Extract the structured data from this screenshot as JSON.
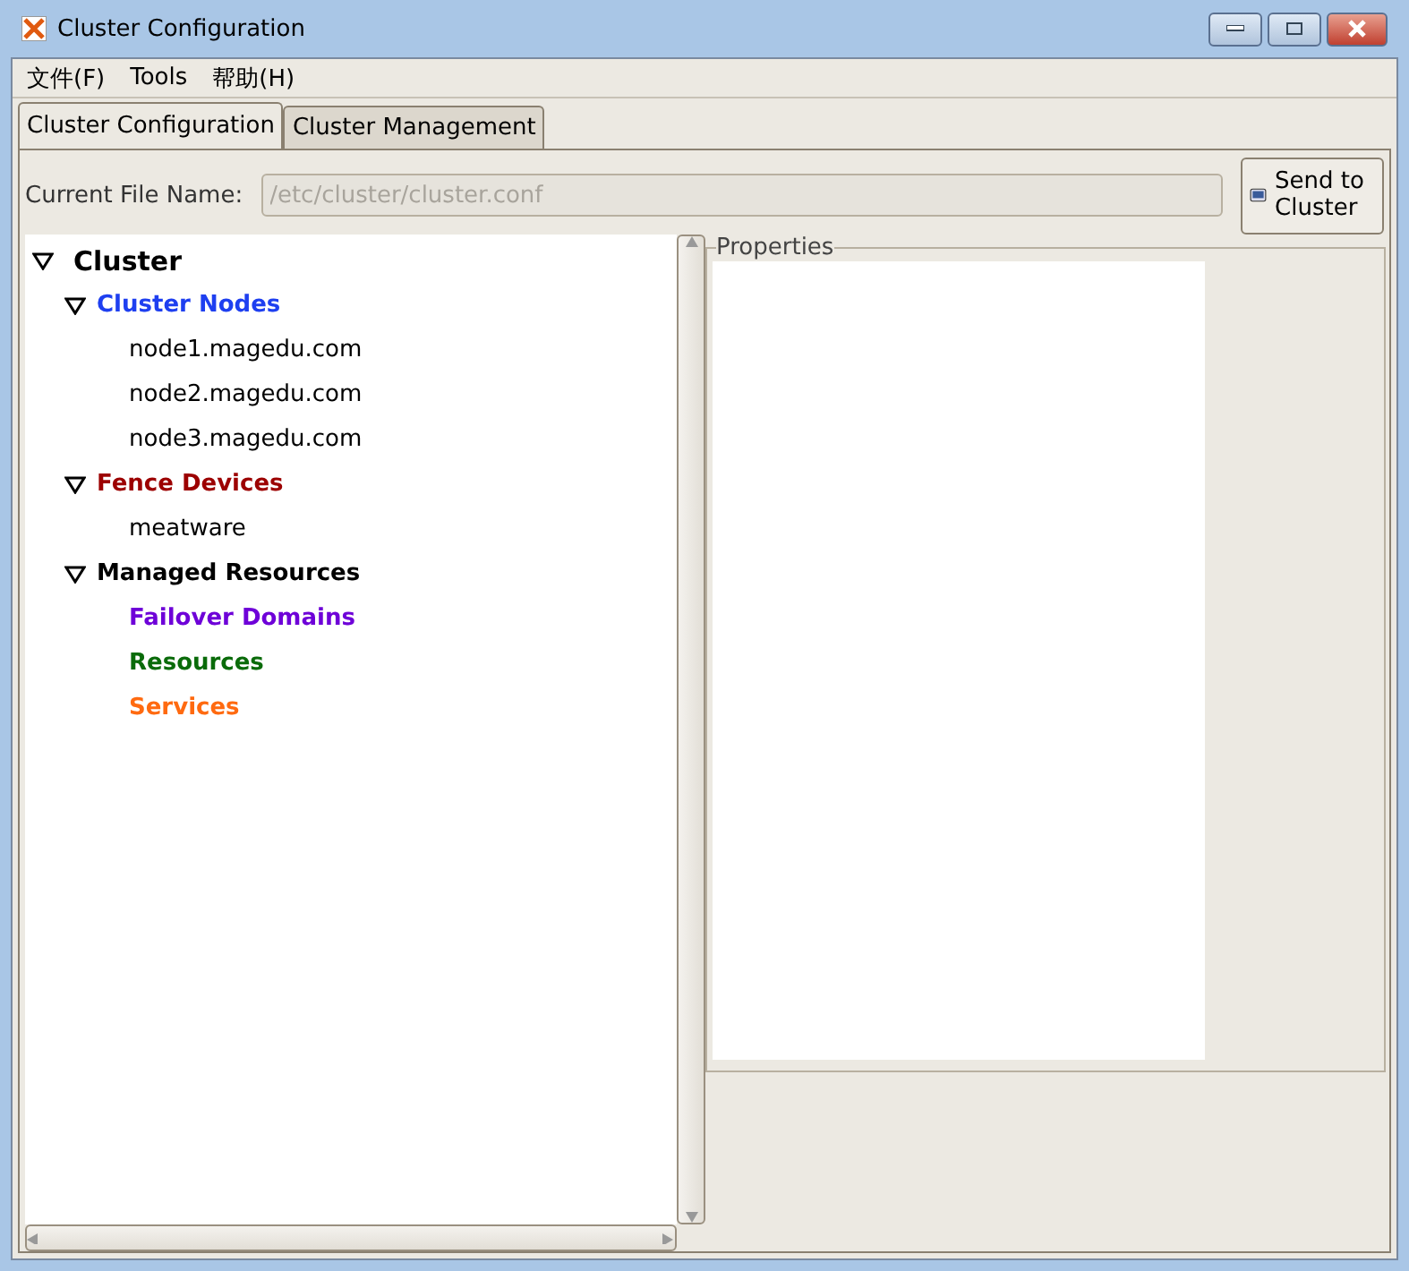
{
  "window": {
    "title": "Cluster Configuration"
  },
  "menu": [
    "文件(F)",
    "Tools",
    "帮助(H)"
  ],
  "tabs": [
    {
      "label": "Cluster Configuration",
      "selected": true
    },
    {
      "label": "Cluster Management",
      "selected": false
    }
  ],
  "file_name": {
    "label": "Current File Name:",
    "value": "/etc/cluster/cluster.conf",
    "disabled": true
  },
  "send_button": {
    "label": "Send to Cluster"
  },
  "tree": [
    {
      "label": "Cluster",
      "kind": "root",
      "expanded": true,
      "children": [
        {
          "label": "Cluster Nodes",
          "kind": "group",
          "color": "#1e3ff0",
          "expanded": true,
          "children": [
            {
              "label": "node1.magedu.com",
              "kind": "entry"
            },
            {
              "label": "node2.magedu.com",
              "kind": "entry"
            },
            {
              "label": "node3.magedu.com",
              "kind": "entry"
            }
          ]
        },
        {
          "label": "Fence Devices",
          "kind": "group",
          "color": "#9c0000",
          "expanded": true,
          "children": [
            {
              "label": "meatware",
              "kind": "entry"
            }
          ]
        },
        {
          "label": "Managed Resources",
          "kind": "group",
          "color": "#000000",
          "expanded": true,
          "children": [
            {
              "label": "Failover Domains",
              "kind": "group",
              "color": "#6e00d8"
            },
            {
              "label": "Resources",
              "kind": "group",
              "color": "#0a6b0a"
            },
            {
              "label": "Services",
              "kind": "group",
              "color": "#ff6a10"
            }
          ]
        }
      ]
    }
  ],
  "properties": {
    "title": "Properties"
  }
}
